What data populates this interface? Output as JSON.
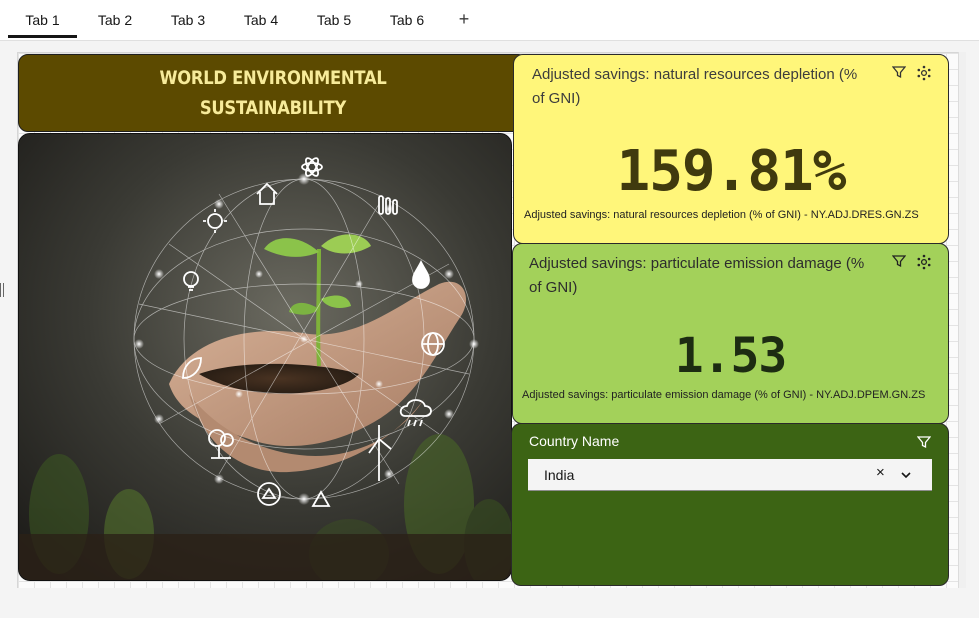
{
  "tabs": [
    {
      "label": "Tab 1",
      "active": true
    },
    {
      "label": "Tab 2",
      "active": false
    },
    {
      "label": "Tab 3",
      "active": false
    },
    {
      "label": "Tab 4",
      "active": false
    },
    {
      "label": "Tab 5",
      "active": false
    },
    {
      "label": "Tab 6",
      "active": false
    }
  ],
  "add_tab_label": "+",
  "title": "WORLD ENVIRONMENTAL\nSUSTAINABILITY",
  "image": {
    "icons": [
      "home-icon",
      "atom-icon",
      "thermometer-icon",
      "water-drop-icon",
      "globe-icon",
      "weather-icon",
      "wind-turbine-icon",
      "recycle-icon",
      "eco-home-icon",
      "tree-icon",
      "leaf-icon",
      "bulb-icon",
      "sun-icon"
    ]
  },
  "kpi_natural_resources": {
    "title": "Adjusted savings: natural resources depletion (% of GNI)",
    "value": "159.81%",
    "caption": "Adjusted savings: natural resources depletion (% of GNI) - NY.ADJ.DRES.GN.ZS",
    "icons": [
      "filter-icon",
      "settings-icon"
    ]
  },
  "kpi_particulate": {
    "title": "Adjusted savings: particulate emission damage (% of GNI)",
    "value": "1.53",
    "caption": "Adjusted savings: particulate emission damage (% of GNI) - NY.ADJ.DPEM.GN.ZS",
    "icons": [
      "filter-icon",
      "settings-icon"
    ]
  },
  "country_filter": {
    "label": "Country Name",
    "selected": "India",
    "clear_symbol": "×"
  },
  "colors": {
    "title_bg": "#5c4a00",
    "title_text": "#f7eb9a",
    "kpi1_bg": "#fff67a",
    "kpi2_bg": "#a3d15a",
    "filter_bg": "#3c6414"
  }
}
